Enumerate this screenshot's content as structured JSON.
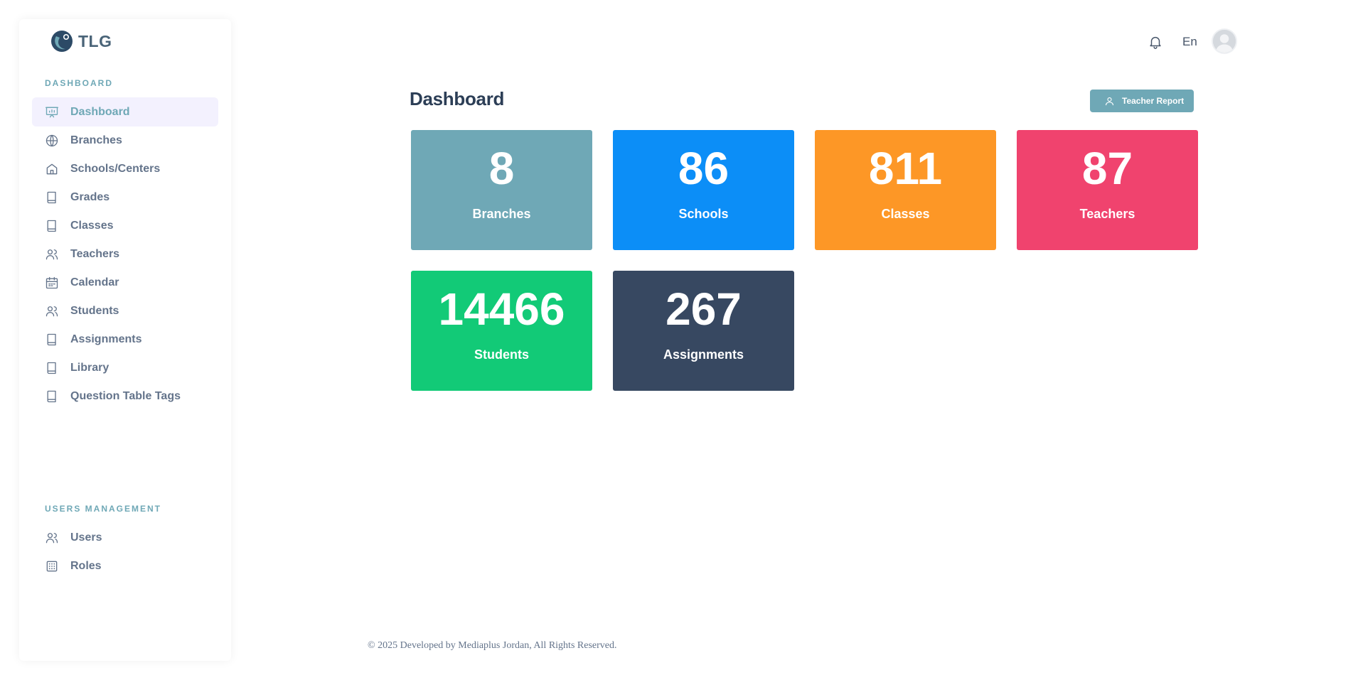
{
  "app": {
    "logo_text": "TLG"
  },
  "sidebar": {
    "sections": [
      {
        "title": "DASHBOARD"
      },
      {
        "title": "USERS MANAGEMENT"
      }
    ],
    "items": [
      {
        "label": "Dashboard",
        "icon": "presentation-chart-icon",
        "active": true
      },
      {
        "label": "Branches",
        "icon": "globe-icon"
      },
      {
        "label": "Schools/Centers",
        "icon": "home-icon"
      },
      {
        "label": "Grades",
        "icon": "book-icon"
      },
      {
        "label": "Classes",
        "icon": "book-icon"
      },
      {
        "label": "Teachers",
        "icon": "users-icon"
      },
      {
        "label": "Calendar",
        "icon": "calendar-icon"
      },
      {
        "label": "Students",
        "icon": "users-icon"
      },
      {
        "label": "Assignments",
        "icon": "book-icon"
      },
      {
        "label": "Library",
        "icon": "book-icon"
      },
      {
        "label": "Question Table Tags",
        "icon": "book-icon"
      },
      {
        "label": "Users",
        "icon": "users-icon"
      },
      {
        "label": "Roles",
        "icon": "grid-icon"
      }
    ]
  },
  "topbar": {
    "language": "En",
    "notification_icon": "bell-icon",
    "avatar_icon": "user-avatar-icon"
  },
  "main": {
    "title": "Dashboard",
    "report_button": "Teacher Report",
    "cards": [
      {
        "value": "8",
        "label": "Branches",
        "color": "#6fa8b6"
      },
      {
        "value": "86",
        "label": "Schools",
        "color": "#0c8ef7"
      },
      {
        "value": "811",
        "label": "Classes",
        "color": "#fd9726"
      },
      {
        "value": "87",
        "label": "Teachers",
        "color": "#f0436e"
      },
      {
        "value": "14466",
        "label": "Students",
        "color": "#12ca77"
      },
      {
        "value": "267",
        "label": "Assignments",
        "color": "#374861"
      }
    ]
  },
  "footer": {
    "text": "© 2025 Developed by Mediaplus Jordan, All Rights Reserved."
  }
}
